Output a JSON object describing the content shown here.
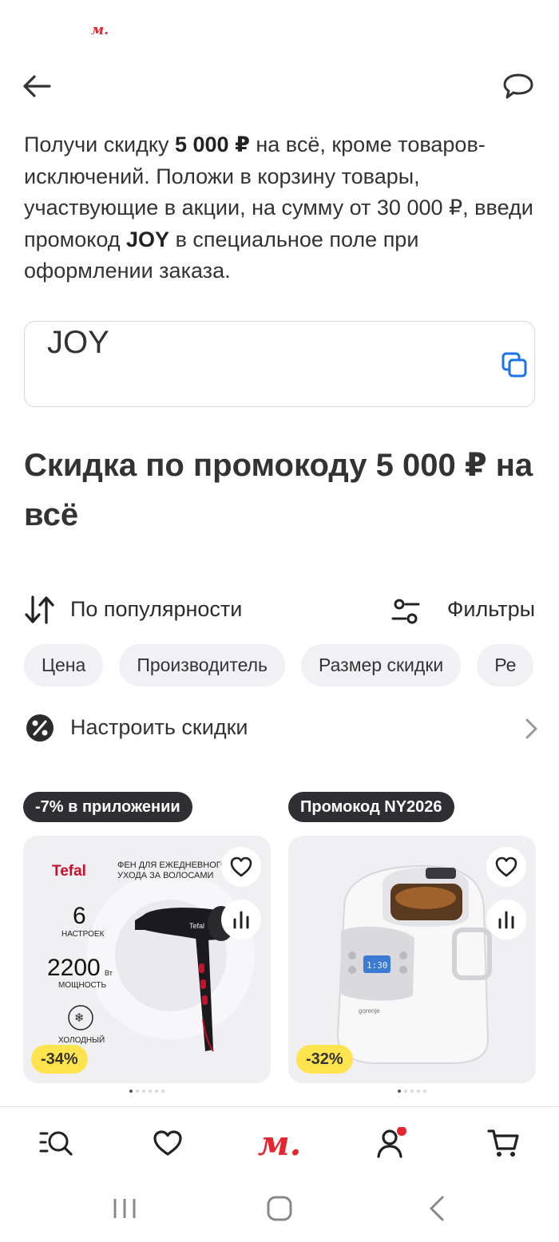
{
  "status_bar": {
    "logo": "м."
  },
  "topbar": {
    "back_icon": "arrow-left-icon",
    "chat_icon": "chat-bubble-icon"
  },
  "promo": {
    "desc_1": "Получи скидку ",
    "desc_amount": "5 000 ₽",
    "desc_2": " на всё, кроме товаров-исключений. Положи в корзину товары, участвующие в акции, на сумму от 30 000 ₽, введи промокод ",
    "desc_code": "JOY",
    "desc_3": " в специальное поле при оформлении заказа.",
    "code": "JOY",
    "copy_icon": "copy-icon"
  },
  "section_title": "Скидка по промокоду 5 000 ₽ на всё",
  "sort": {
    "label": "По популярности",
    "filters_label": "Фильтры"
  },
  "chips": [
    "Цена",
    "Производитель",
    "Размер скидки",
    "Ре"
  ],
  "discounts": {
    "label": "Настроить скидки"
  },
  "products": [
    {
      "badge": "-7% в приложении",
      "sale": "-34%",
      "image": "tefal-hair-dryer"
    },
    {
      "badge": "Промокод NY2026",
      "sale": "-32%",
      "image": "gorenje-bread-maker"
    }
  ],
  "bottom_nav": {
    "logo": "м."
  },
  "colors": {
    "accent": "#e3262f",
    "chip_bg": "#f1f1f5",
    "badge_bg": "#2f2f33",
    "sale_tag": "#ffe44d",
    "copy_blue": "#1a73e8"
  }
}
